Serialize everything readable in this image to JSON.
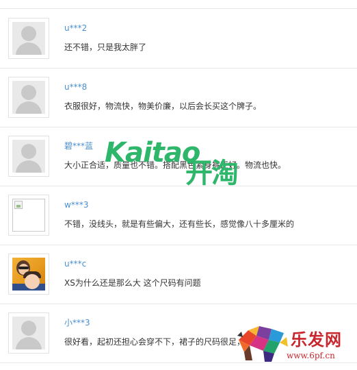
{
  "reviews": [
    {
      "user": "u***2",
      "text": "还不错，只是我太胖了",
      "avatar": "default-avatar-icon"
    },
    {
      "user": "u***8",
      "text": "衣服很好，物流快，物美价廉，以后会长买这个牌子。",
      "avatar": "default-avatar-icon"
    },
    {
      "user": "碧***蓝",
      "text": "大小正合适，质量也不错。搭配黑色紧身裤正好。物流也快。",
      "avatar": "default-avatar-icon"
    },
    {
      "user": "w***3",
      "text": "不错，没线头，就是有些偏大，还有些长，感觉像八十多厘米的",
      "avatar": "broken-image-icon"
    },
    {
      "user": "u***c",
      "text": "XS为什么还是那么大 这个尺码有问题",
      "avatar": "user-photo"
    },
    {
      "user": "小***3",
      "text": "很好看，起初还担心会穿不下，裙子的尺码很足，",
      "avatar": "default-avatar-icon"
    }
  ],
  "watermarks": {
    "kaitao_latin": "Kaitao",
    "kaitao_cn": "开淘",
    "lefa_cn": "乐发网",
    "lefa_url": "www.6pf.cn"
  },
  "colors": {
    "username": "#4a8fd0",
    "text": "#333333",
    "divider": "#e6e6e6",
    "kaitao_green": "#2eb66a",
    "lefa_red": "#c8262d"
  }
}
